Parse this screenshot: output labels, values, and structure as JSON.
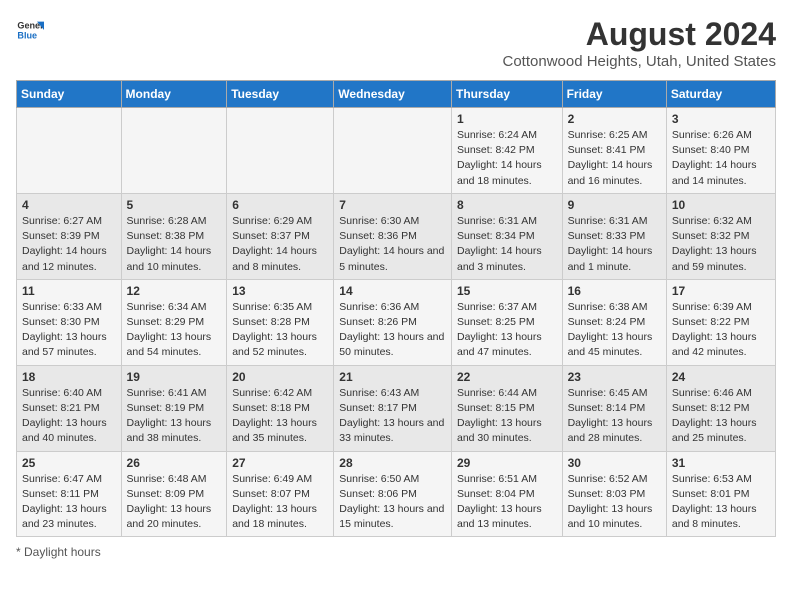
{
  "logo": {
    "line1": "General",
    "line2": "Blue"
  },
  "title": "August 2024",
  "subtitle": "Cottonwood Heights, Utah, United States",
  "days_of_week": [
    "Sunday",
    "Monday",
    "Tuesday",
    "Wednesday",
    "Thursday",
    "Friday",
    "Saturday"
  ],
  "weeks": [
    [
      {
        "num": "",
        "sunrise": "",
        "sunset": "",
        "daylight": ""
      },
      {
        "num": "",
        "sunrise": "",
        "sunset": "",
        "daylight": ""
      },
      {
        "num": "",
        "sunrise": "",
        "sunset": "",
        "daylight": ""
      },
      {
        "num": "",
        "sunrise": "",
        "sunset": "",
        "daylight": ""
      },
      {
        "num": "1",
        "sunrise": "Sunrise: 6:24 AM",
        "sunset": "Sunset: 8:42 PM",
        "daylight": "Daylight: 14 hours and 18 minutes."
      },
      {
        "num": "2",
        "sunrise": "Sunrise: 6:25 AM",
        "sunset": "Sunset: 8:41 PM",
        "daylight": "Daylight: 14 hours and 16 minutes."
      },
      {
        "num": "3",
        "sunrise": "Sunrise: 6:26 AM",
        "sunset": "Sunset: 8:40 PM",
        "daylight": "Daylight: 14 hours and 14 minutes."
      }
    ],
    [
      {
        "num": "4",
        "sunrise": "Sunrise: 6:27 AM",
        "sunset": "Sunset: 8:39 PM",
        "daylight": "Daylight: 14 hours and 12 minutes."
      },
      {
        "num": "5",
        "sunrise": "Sunrise: 6:28 AM",
        "sunset": "Sunset: 8:38 PM",
        "daylight": "Daylight: 14 hours and 10 minutes."
      },
      {
        "num": "6",
        "sunrise": "Sunrise: 6:29 AM",
        "sunset": "Sunset: 8:37 PM",
        "daylight": "Daylight: 14 hours and 8 minutes."
      },
      {
        "num": "7",
        "sunrise": "Sunrise: 6:30 AM",
        "sunset": "Sunset: 8:36 PM",
        "daylight": "Daylight: 14 hours and 5 minutes."
      },
      {
        "num": "8",
        "sunrise": "Sunrise: 6:31 AM",
        "sunset": "Sunset: 8:34 PM",
        "daylight": "Daylight: 14 hours and 3 minutes."
      },
      {
        "num": "9",
        "sunrise": "Sunrise: 6:31 AM",
        "sunset": "Sunset: 8:33 PM",
        "daylight": "Daylight: 14 hours and 1 minute."
      },
      {
        "num": "10",
        "sunrise": "Sunrise: 6:32 AM",
        "sunset": "Sunset: 8:32 PM",
        "daylight": "Daylight: 13 hours and 59 minutes."
      }
    ],
    [
      {
        "num": "11",
        "sunrise": "Sunrise: 6:33 AM",
        "sunset": "Sunset: 8:30 PM",
        "daylight": "Daylight: 13 hours and 57 minutes."
      },
      {
        "num": "12",
        "sunrise": "Sunrise: 6:34 AM",
        "sunset": "Sunset: 8:29 PM",
        "daylight": "Daylight: 13 hours and 54 minutes."
      },
      {
        "num": "13",
        "sunrise": "Sunrise: 6:35 AM",
        "sunset": "Sunset: 8:28 PM",
        "daylight": "Daylight: 13 hours and 52 minutes."
      },
      {
        "num": "14",
        "sunrise": "Sunrise: 6:36 AM",
        "sunset": "Sunset: 8:26 PM",
        "daylight": "Daylight: 13 hours and 50 minutes."
      },
      {
        "num": "15",
        "sunrise": "Sunrise: 6:37 AM",
        "sunset": "Sunset: 8:25 PM",
        "daylight": "Daylight: 13 hours and 47 minutes."
      },
      {
        "num": "16",
        "sunrise": "Sunrise: 6:38 AM",
        "sunset": "Sunset: 8:24 PM",
        "daylight": "Daylight: 13 hours and 45 minutes."
      },
      {
        "num": "17",
        "sunrise": "Sunrise: 6:39 AM",
        "sunset": "Sunset: 8:22 PM",
        "daylight": "Daylight: 13 hours and 42 minutes."
      }
    ],
    [
      {
        "num": "18",
        "sunrise": "Sunrise: 6:40 AM",
        "sunset": "Sunset: 8:21 PM",
        "daylight": "Daylight: 13 hours and 40 minutes."
      },
      {
        "num": "19",
        "sunrise": "Sunrise: 6:41 AM",
        "sunset": "Sunset: 8:19 PM",
        "daylight": "Daylight: 13 hours and 38 minutes."
      },
      {
        "num": "20",
        "sunrise": "Sunrise: 6:42 AM",
        "sunset": "Sunset: 8:18 PM",
        "daylight": "Daylight: 13 hours and 35 minutes."
      },
      {
        "num": "21",
        "sunrise": "Sunrise: 6:43 AM",
        "sunset": "Sunset: 8:17 PM",
        "daylight": "Daylight: 13 hours and 33 minutes."
      },
      {
        "num": "22",
        "sunrise": "Sunrise: 6:44 AM",
        "sunset": "Sunset: 8:15 PM",
        "daylight": "Daylight: 13 hours and 30 minutes."
      },
      {
        "num": "23",
        "sunrise": "Sunrise: 6:45 AM",
        "sunset": "Sunset: 8:14 PM",
        "daylight": "Daylight: 13 hours and 28 minutes."
      },
      {
        "num": "24",
        "sunrise": "Sunrise: 6:46 AM",
        "sunset": "Sunset: 8:12 PM",
        "daylight": "Daylight: 13 hours and 25 minutes."
      }
    ],
    [
      {
        "num": "25",
        "sunrise": "Sunrise: 6:47 AM",
        "sunset": "Sunset: 8:11 PM",
        "daylight": "Daylight: 13 hours and 23 minutes."
      },
      {
        "num": "26",
        "sunrise": "Sunrise: 6:48 AM",
        "sunset": "Sunset: 8:09 PM",
        "daylight": "Daylight: 13 hours and 20 minutes."
      },
      {
        "num": "27",
        "sunrise": "Sunrise: 6:49 AM",
        "sunset": "Sunset: 8:07 PM",
        "daylight": "Daylight: 13 hours and 18 minutes."
      },
      {
        "num": "28",
        "sunrise": "Sunrise: 6:50 AM",
        "sunset": "Sunset: 8:06 PM",
        "daylight": "Daylight: 13 hours and 15 minutes."
      },
      {
        "num": "29",
        "sunrise": "Sunrise: 6:51 AM",
        "sunset": "Sunset: 8:04 PM",
        "daylight": "Daylight: 13 hours and 13 minutes."
      },
      {
        "num": "30",
        "sunrise": "Sunrise: 6:52 AM",
        "sunset": "Sunset: 8:03 PM",
        "daylight": "Daylight: 13 hours and 10 minutes."
      },
      {
        "num": "31",
        "sunrise": "Sunrise: 6:53 AM",
        "sunset": "Sunset: 8:01 PM",
        "daylight": "Daylight: 13 hours and 8 minutes."
      }
    ]
  ],
  "footer": "Daylight hours"
}
